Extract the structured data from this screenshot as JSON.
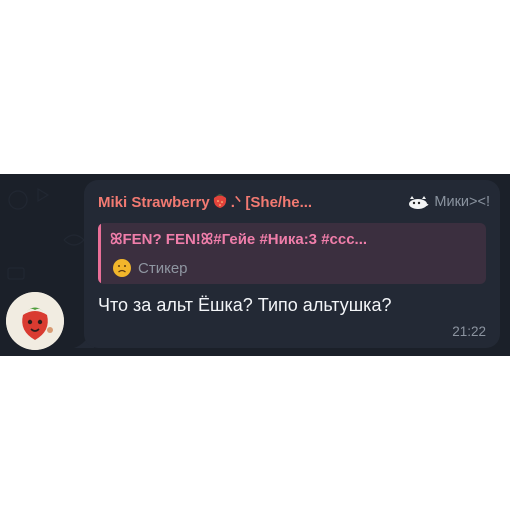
{
  "message": {
    "sender_name": "Miki Strawberry",
    "sender_suffix": ".ᐠ [She/he...",
    "sender_tag": "Мики><!",
    "reply": {
      "title": "ꕤFEN? FEN!ꕤ#Гейе #Ника:3 #ссс...",
      "subtitle": "Стикер"
    },
    "text": "Что за альт Ёшка? Типо альтушка?",
    "time": "21:22"
  },
  "icons": {
    "avatar": "strawberry-avatar",
    "sender_emoji": "strawberry-emoji",
    "tag_emoji": "cat-emoji",
    "reply_emoji": "worried-face-emoji"
  },
  "colors": {
    "chat_background": "#1b2029",
    "bubble": "#232935",
    "sender_name": "#f27a72",
    "reply_accent": "#ea6f98",
    "reply_background": "#3b2f3f",
    "message_text": "#f3f5f8",
    "meta_text": "#8c94a0"
  }
}
